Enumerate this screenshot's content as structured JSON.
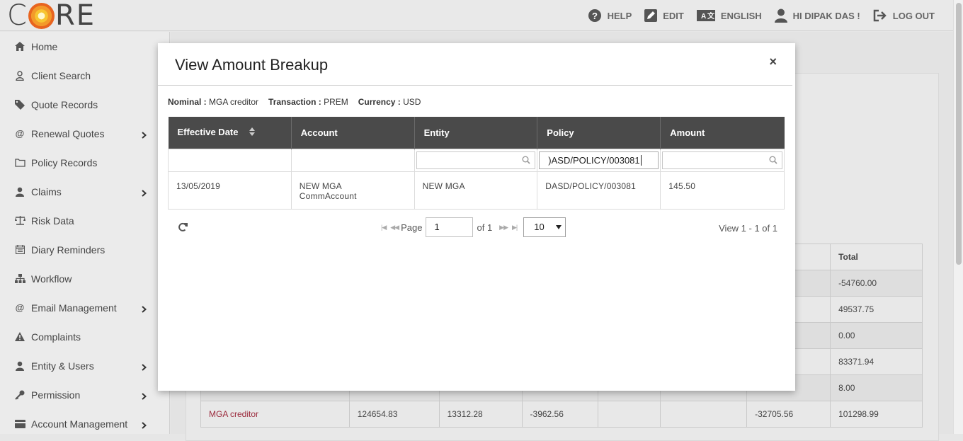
{
  "header": {
    "logo": "CORE",
    "nav": [
      {
        "label": "HELP",
        "icon": "help-icon"
      },
      {
        "label": "EDIT",
        "icon": "edit-icon"
      },
      {
        "label": "ENGLISH",
        "icon": "language-icon"
      },
      {
        "label": "HI DIPAK DAS !",
        "icon": "user-icon"
      },
      {
        "label": "LOG OUT",
        "icon": "logout-icon"
      }
    ]
  },
  "sidebar": {
    "items": [
      {
        "label": "Home",
        "icon": "home-icon",
        "has_submenu": false
      },
      {
        "label": "Client Search",
        "icon": "user-outline-icon",
        "has_submenu": false
      },
      {
        "label": "Quote Records",
        "icon": "tag-icon",
        "has_submenu": false
      },
      {
        "label": "Renewal Quotes",
        "icon": "at-icon",
        "has_submenu": true
      },
      {
        "label": "Policy Records",
        "icon": "folder-icon",
        "has_submenu": false
      },
      {
        "label": "Claims",
        "icon": "user-icon",
        "has_submenu": true
      },
      {
        "label": "Risk Data",
        "icon": "scale-icon",
        "has_submenu": false
      },
      {
        "label": "Diary Reminders",
        "icon": "calendar-icon",
        "has_submenu": false
      },
      {
        "label": "Workflow",
        "icon": "sitemap-icon",
        "has_submenu": false
      },
      {
        "label": "Email Management",
        "icon": "at-icon",
        "has_submenu": true
      },
      {
        "label": "Complaints",
        "icon": "warning-icon",
        "has_submenu": false
      },
      {
        "label": "Entity & Users",
        "icon": "user-icon",
        "has_submenu": true
      },
      {
        "label": "Permission",
        "icon": "key-icon",
        "has_submenu": true
      },
      {
        "label": "Account Management",
        "icon": "card-icon",
        "has_submenu": true
      }
    ]
  },
  "background_table": {
    "header_total": "Total",
    "totals": [
      "-54760.00",
      "49537.75",
      "0.00",
      "83371.94",
      "8.00"
    ],
    "last_row": [
      "MGA creditor",
      "124654.83",
      "13312.28",
      "-3962.56",
      "",
      "",
      "-32705.56",
      "101298.99"
    ]
  },
  "modal": {
    "title": "View Amount Breakup",
    "close": "×",
    "meta": {
      "nominal_label": "Nominal :",
      "nominal_value": "MGA creditor",
      "transaction_label": "Transaction :",
      "transaction_value": "PREM",
      "currency_label": "Currency :",
      "currency_value": "USD"
    },
    "columns": [
      "Effective Date",
      "Account",
      "Entity",
      "Policy",
      "Amount"
    ],
    "filters": {
      "entity": "",
      "policy": ")ASD/POLICY/003081",
      "amount": ""
    },
    "rows": [
      {
        "effective_date": "13/05/2019",
        "account_line1": "NEW MGA",
        "account_line2": "CommAccount",
        "entity": "NEW MGA",
        "policy": "DASD/POLICY/003081",
        "amount": "145.50"
      }
    ],
    "pager": {
      "page_label": "Page",
      "page_value": "1",
      "of_label": "of 1",
      "rows_per_page": "10",
      "view_text": "View 1 - 1 of 1"
    }
  }
}
